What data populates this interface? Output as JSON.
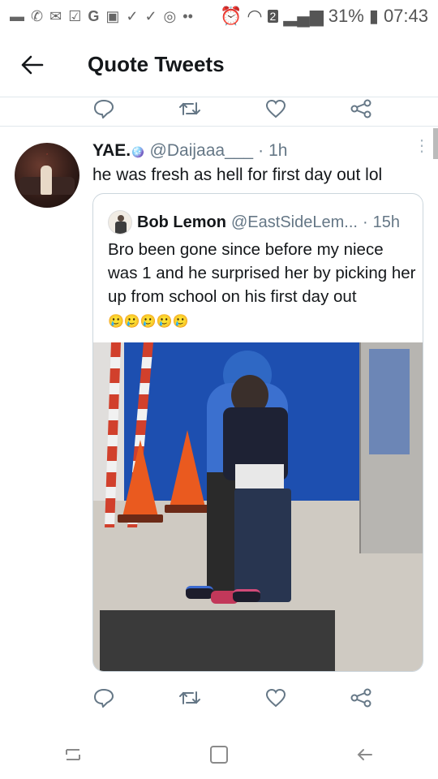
{
  "status_bar": {
    "battery": "31%",
    "time": "07:43",
    "sim_badge": "2"
  },
  "header": {
    "title": "Quote Tweets",
    "back_icon": "arrow-left-icon"
  },
  "tweet": {
    "display_name": "YAE.",
    "emoji_placeholder": "🪩",
    "handle": "@Daijaaa___",
    "separator": "·",
    "time": "1h",
    "text": "he was fresh as hell for first day out lol",
    "quoted": {
      "display_name": "Bob Lemon",
      "handle": "@EastSideLem...",
      "separator": "·",
      "time": "15h",
      "text": "Bro been gone since before my niece was 1 and he surprised her by picking her up from school on his first day out",
      "emoji_text": "🥲🥲🥲🥲🥲"
    }
  },
  "actions": [
    "reply-icon",
    "retweet-icon",
    "like-icon",
    "share-icon"
  ],
  "nav": [
    "recent-apps-icon",
    "home-icon",
    "back-icon"
  ],
  "colors": {
    "text": "#14171a",
    "secondary": "#657786",
    "border": "#e1e8ed"
  }
}
